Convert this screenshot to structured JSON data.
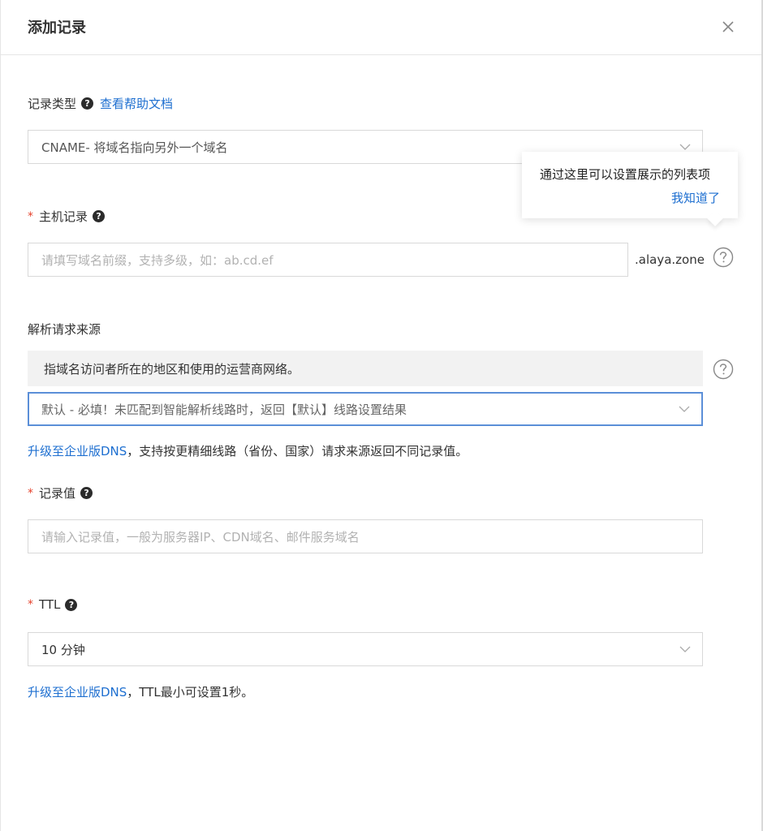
{
  "dialog": {
    "title": "添加记录",
    "close_icon": "close-icon"
  },
  "record_type": {
    "label": "记录类型",
    "help_link": "查看帮助文档",
    "value": "CNAME- 将域名指向另外一个域名"
  },
  "tooltip": {
    "text": "通过这里可以设置展示的列表项",
    "ack": "我知道了"
  },
  "host_record": {
    "required_mark": "*",
    "label": "主机记录",
    "placeholder": "请填写域名前缀，支持多级，如：ab.cd.ef",
    "suffix": ".alaya.zone"
  },
  "source": {
    "label": "解析请求来源",
    "info": "指域名访问者所在的地区和使用的运营商网络。",
    "value": "默认 - 必填！未匹配到智能解析线路时，返回【默认】线路设置结果",
    "upgrade_link": "升级至企业版DNS",
    "upgrade_note": "，支持按更精细线路（省份、国家）请求来源返回不同记录值。"
  },
  "record_value": {
    "required_mark": "*",
    "label": "记录值",
    "placeholder": "请输入记录值，一般为服务器IP、CDN域名、邮件服务域名"
  },
  "ttl": {
    "required_mark": "*",
    "label": "TTL",
    "value": "10 分钟",
    "upgrade_link": "升级至企业版DNS",
    "upgrade_note": "，TTL最小可设置1秒。"
  },
  "icons": {
    "help_badge": "?",
    "help_circle": "question-circle-icon",
    "chevron": "chevron-down-icon"
  }
}
